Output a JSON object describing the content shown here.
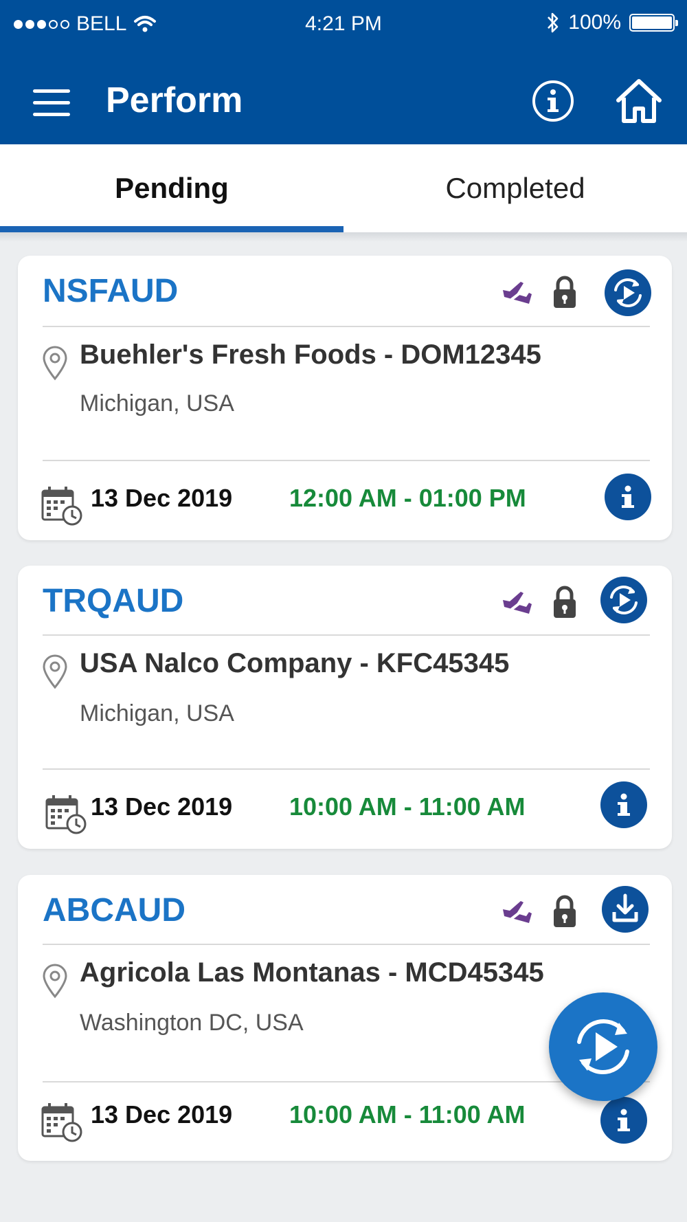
{
  "status_bar": {
    "carrier": "BELL",
    "time": "4:21 PM",
    "battery": "100%"
  },
  "app_bar": {
    "title": "Perform",
    "icons": [
      "menu-icon",
      "info-icon",
      "home-icon"
    ]
  },
  "tabs": [
    {
      "label": "Pending",
      "active": true
    },
    {
      "label": "Completed",
      "active": false
    }
  ],
  "cards": [
    {
      "code": "NSFAUD",
      "site": "Buehler's Fresh Foods - DOM12345",
      "region": "Michigan, USA",
      "date": "13 Dec 2019",
      "time_range": "12:00 AM - 01:00 PM",
      "action_icon": "play-sync-icon"
    },
    {
      "code": "TRQAUD",
      "site": "USA Nalco Company  - KFC45345",
      "region": "Michigan, USA",
      "date": "13 Dec 2019",
      "time_range": "10:00 AM - 11:00 AM",
      "action_icon": "play-sync-icon"
    },
    {
      "code": "ABCAUD",
      "site": "Agricola Las Montanas  - MCD45345",
      "region": "Washington DC, USA",
      "date": "13 Dec 2019",
      "time_range": "10:00 AM - 11:00 AM",
      "action_icon": "download-icon"
    }
  ],
  "colors": {
    "primary": "#004f9a",
    "accent": "#1b74c6",
    "time_green": "#178a3a",
    "offline_purple": "#6a3d8f"
  }
}
